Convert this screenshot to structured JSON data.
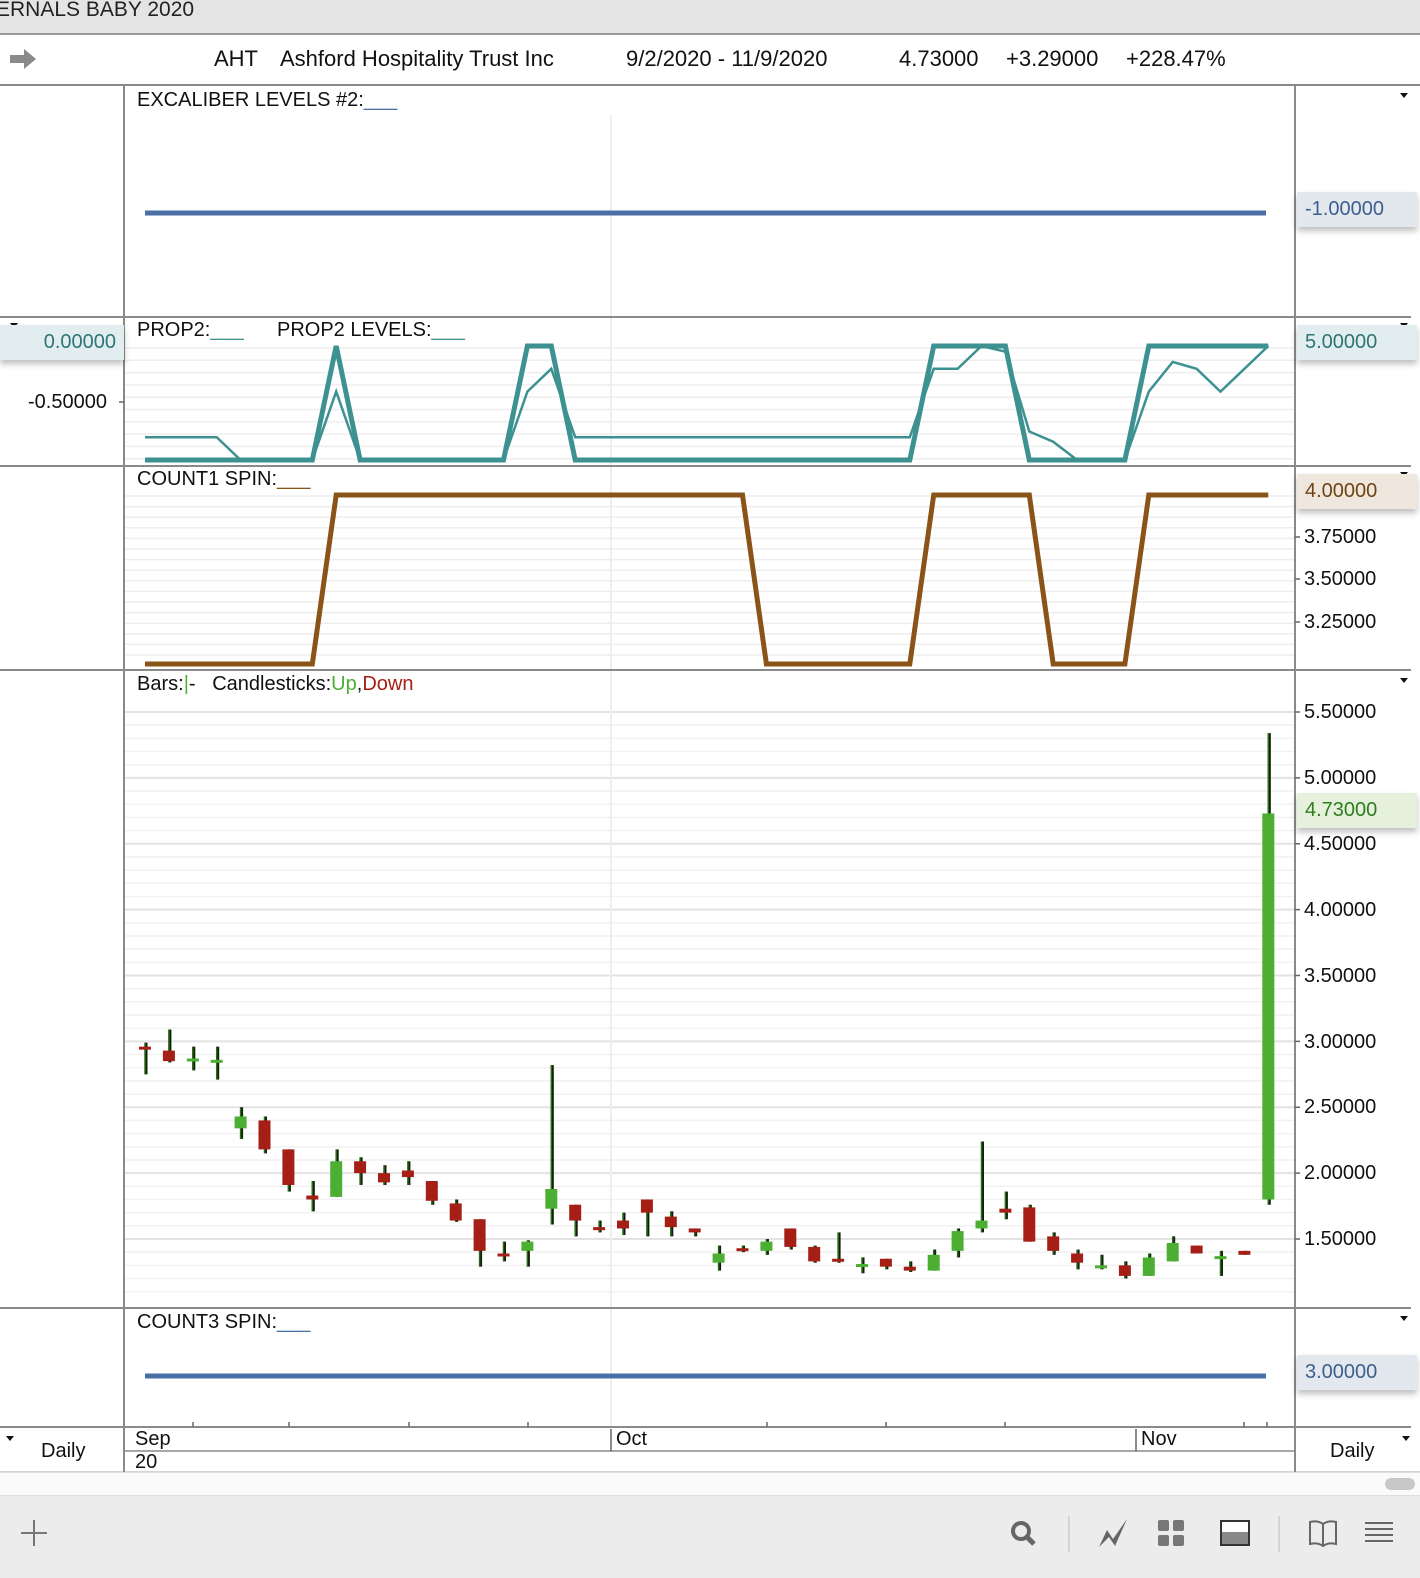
{
  "window": {
    "title": "ERNALS BABY 2020"
  },
  "info": {
    "symbol": "AHT",
    "name": "Ashford Hospitality Trust Inc",
    "range": "9/2/2020 - 11/9/2020",
    "last": "4.73000",
    "change": "+3.29000",
    "pct": "+228.47%"
  },
  "panels": {
    "excaliber": {
      "label": "EXCALIBER LEVELS #2:",
      "value_tag": "-1.00000"
    },
    "prop2": {
      "label1": "PROP2:",
      "label2": "PROP2 LEVELS:",
      "left_tag": "0.00000",
      "left_tick": "-0.50000",
      "right_tag": "5.00000"
    },
    "count1": {
      "label": "COUNT1 SPIN:",
      "value_tag": "4.00000",
      "ticks": [
        "3.75000",
        "3.50000",
        "3.25000"
      ]
    },
    "price": {
      "label_bars": "Bars:",
      "label_candles": "Candlesticks:",
      "up": "Up",
      "comma": ",",
      "down": "Down",
      "value_tag": "4.73000",
      "ticks": [
        "5.50000",
        "5.00000",
        "4.50000",
        "4.00000",
        "3.50000",
        "3.00000",
        "2.50000",
        "2.00000",
        "1.50000"
      ]
    },
    "count3": {
      "label": "COUNT3 SPIN:",
      "value_tag": "3.00000"
    }
  },
  "xaxis": {
    "sep": "Sep",
    "year": "20",
    "oct": "Oct",
    "nov": "Nov",
    "left_period": "Daily",
    "right_period": "Daily"
  },
  "colors": {
    "up": "#4caf34",
    "down": "#a51f17",
    "prop2": "#3d9191",
    "count1": "#8a5418",
    "level": "#4a6fa5"
  },
  "toolbar": {
    "icons": [
      "add-icon",
      "search-icon",
      "draw-icon",
      "grid-icon",
      "layout-icon",
      "book-icon",
      "menu-icon"
    ]
  },
  "chart_data": [
    {
      "type": "line",
      "title": "EXCALIBER LEVELS #2",
      "series": [
        {
          "name": "EXCALIBER LEVELS #2",
          "constant": -1.0
        }
      ]
    },
    {
      "type": "line",
      "title": "PROP2",
      "x_count": 48,
      "series": [
        {
          "name": "PROP2 LEVELS",
          "values": [
            -1,
            -1,
            -1,
            -1,
            -1,
            -1,
            -1,
            -1,
            0,
            -1,
            -1,
            -1,
            -1,
            -1,
            -1,
            -1,
            0,
            0,
            -1,
            -1,
            -1,
            -1,
            -1,
            -1,
            -1,
            -1,
            -1,
            -1,
            -1,
            -1,
            -1,
            -1,
            -1,
            0,
            0,
            0,
            0,
            -1,
            -1,
            -1,
            -1,
            -1,
            0,
            0,
            0,
            0,
            0,
            0
          ]
        },
        {
          "name": "PROP2",
          "values": [
            -0.8,
            -0.8,
            -0.8,
            -0.8,
            -1,
            -1,
            -1,
            -1,
            -0.4,
            -1,
            -1,
            -1,
            -1,
            -1,
            -1,
            -1,
            -0.4,
            -0.2,
            -0.8,
            -0.8,
            -0.8,
            -0.8,
            -0.8,
            -0.8,
            -0.8,
            -0.8,
            -0.8,
            -0.8,
            -0.8,
            -0.8,
            -0.8,
            -0.8,
            -0.8,
            -0.2,
            -0.2,
            0,
            -0.05,
            -0.75,
            -0.84,
            -1,
            -1,
            -1,
            -0.4,
            -0.14,
            -0.2,
            -0.4,
            -0.2,
            0
          ]
        }
      ]
    },
    {
      "type": "line",
      "title": "COUNT1 SPIN",
      "ylim": [
        3,
        4
      ],
      "series": [
        {
          "name": "COUNT1 SPIN",
          "values": [
            3,
            3,
            3,
            3,
            3,
            3,
            3,
            3,
            4,
            4,
            4,
            4,
            4,
            4,
            4,
            4,
            4,
            4,
            4,
            4,
            4,
            4,
            4,
            4,
            4,
            4,
            3,
            3,
            3,
            3,
            3,
            3,
            3,
            4,
            4,
            4,
            4,
            4,
            3,
            3,
            3,
            3,
            4,
            4,
            4,
            4,
            4,
            4
          ]
        }
      ]
    },
    {
      "type": "candlestick",
      "title": "AHT Daily",
      "ylim": [
        1.1,
        5.6
      ],
      "x_labels": [
        "Sep",
        "Oct",
        "Nov"
      ],
      "ohlc": [
        [
          2.96,
          2.99,
          2.75,
          2.95
        ],
        [
          2.93,
          3.09,
          2.84,
          2.85
        ],
        [
          2.86,
          2.96,
          2.78,
          2.87
        ],
        [
          2.85,
          2.96,
          2.71,
          2.86
        ],
        [
          2.34,
          2.5,
          2.26,
          2.43
        ],
        [
          2.4,
          2.43,
          2.15,
          2.18
        ],
        [
          2.18,
          2.18,
          1.86,
          1.91
        ],
        [
          1.83,
          1.94,
          1.71,
          1.8
        ],
        [
          1.82,
          2.18,
          1.82,
          2.09
        ],
        [
          2.09,
          2.12,
          1.91,
          2.0
        ],
        [
          2.0,
          2.06,
          1.91,
          1.93
        ],
        [
          2.02,
          2.09,
          1.91,
          1.97
        ],
        [
          1.94,
          1.94,
          1.76,
          1.79
        ],
        [
          1.77,
          1.8,
          1.63,
          1.64
        ],
        [
          1.65,
          1.65,
          1.29,
          1.41
        ],
        [
          1.39,
          1.48,
          1.33,
          1.38
        ],
        [
          1.41,
          1.49,
          1.29,
          1.48
        ],
        [
          1.73,
          2.82,
          1.61,
          1.88
        ],
        [
          1.76,
          1.76,
          1.52,
          1.64
        ],
        [
          1.59,
          1.64,
          1.55,
          1.58
        ],
        [
          1.64,
          1.7,
          1.53,
          1.58
        ],
        [
          1.8,
          1.8,
          1.52,
          1.7
        ],
        [
          1.67,
          1.71,
          1.52,
          1.59
        ],
        [
          1.58,
          1.58,
          1.52,
          1.55
        ],
        [
          1.32,
          1.45,
          1.26,
          1.39
        ],
        [
          1.43,
          1.45,
          1.4,
          1.41
        ],
        [
          1.41,
          1.5,
          1.38,
          1.48
        ],
        [
          1.58,
          1.58,
          1.42,
          1.44
        ],
        [
          1.44,
          1.45,
          1.32,
          1.33
        ],
        [
          1.35,
          1.55,
          1.32,
          1.33
        ],
        [
          1.3,
          1.36,
          1.24,
          1.31
        ],
        [
          1.35,
          1.35,
          1.27,
          1.29
        ],
        [
          1.29,
          1.33,
          1.25,
          1.26
        ],
        [
          1.26,
          1.42,
          1.26,
          1.38
        ],
        [
          1.41,
          1.58,
          1.36,
          1.56
        ],
        [
          1.58,
          2.24,
          1.55,
          1.64
        ],
        [
          1.73,
          1.86,
          1.65,
          1.7
        ],
        [
          1.74,
          1.76,
          1.48,
          1.48
        ],
        [
          1.52,
          1.55,
          1.38,
          1.41
        ],
        [
          1.39,
          1.42,
          1.27,
          1.32
        ],
        [
          1.29,
          1.38,
          1.27,
          1.3
        ],
        [
          1.3,
          1.33,
          1.2,
          1.22
        ],
        [
          1.22,
          1.39,
          1.22,
          1.36
        ],
        [
          1.33,
          1.52,
          1.33,
          1.47
        ],
        [
          1.45,
          1.45,
          1.39,
          1.39
        ],
        [
          1.36,
          1.41,
          1.22,
          1.37
        ],
        [
          1.41,
          1.41,
          1.38,
          1.38
        ],
        [
          1.8,
          5.34,
          1.76,
          4.73
        ]
      ]
    },
    {
      "type": "line",
      "title": "COUNT3 SPIN",
      "series": [
        {
          "name": "COUNT3 SPIN",
          "constant": 3.0
        }
      ]
    }
  ]
}
